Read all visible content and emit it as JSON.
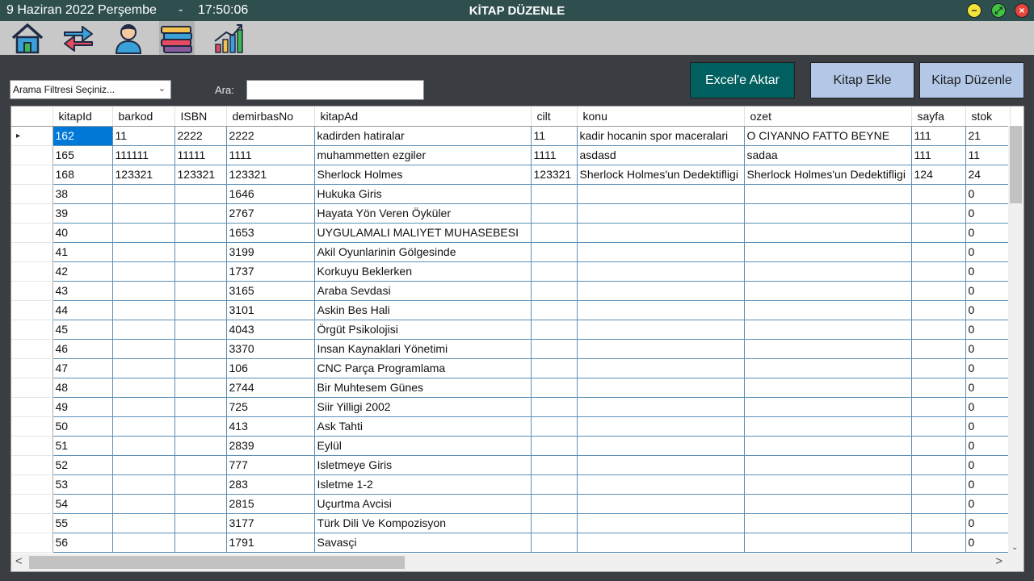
{
  "titlebar": {
    "date": "9 Haziran 2022 Perşembe",
    "separator": "-",
    "time": "17:50:06",
    "title": "KİTAP DÜZENLE",
    "min_glyph": "−",
    "max_glyph": "⤢",
    "close_glyph": "×",
    "colors": {
      "bar": "#2f4f4f",
      "min": "#f2e23a",
      "max": "#3fc53f",
      "close": "#e8453c"
    }
  },
  "toolbar": {
    "icons": [
      "home-icon",
      "transfer-arrows-icon",
      "user-icon",
      "books-icon",
      "chart-growth-icon"
    ],
    "active_index": 3
  },
  "filter": {
    "selected": "Arama Filtresi Seçiniz...",
    "ara_label": "Ara:",
    "search_value": ""
  },
  "buttons": {
    "excel": "Excel'e Aktar",
    "ekle": "Kitap Ekle",
    "duzenle": "Kitap Düzenle",
    "colors": {
      "excel": "#006060",
      "ekle": "#b3c7e6",
      "duzenle": "#b3c7e6"
    }
  },
  "grid": {
    "columns": [
      "kitapId",
      "barkod",
      "ISBN",
      "demirbasNo",
      "kitapAd",
      "cilt",
      "konu",
      "ozet",
      "sayfa",
      "stok"
    ],
    "rows": [
      [
        "162",
        "11",
        "2222",
        "2222",
        "kadirden hatiralar",
        "11",
        "kadir hocanin spor maceralari",
        "O CIYANNO FATTO BEYNE",
        "111",
        "21"
      ],
      [
        "165",
        "111111",
        "11111",
        "1111",
        "muhammetten  ezgiler",
        "1111",
        "asdasd",
        "sadaa",
        "111",
        "11"
      ],
      [
        "168",
        "123321",
        "123321",
        "123321",
        "Sherlock Holmes",
        "123321",
        "Sherlock Holmes'un Dedektifligi",
        "Sherlock Holmes'un Dedektifligi",
        "124",
        "24"
      ],
      [
        "38",
        "",
        "",
        "1646",
        "Hukuka Giris",
        "",
        "",
        "",
        "",
        "0"
      ],
      [
        "39",
        "",
        "",
        "2767",
        "Hayata Yön Veren Öyküler",
        "",
        "",
        "",
        "",
        "0"
      ],
      [
        "40",
        "",
        "",
        "1653",
        "UYGULAMALI MALIYET MUHASEBESI",
        "",
        "",
        "",
        "",
        "0"
      ],
      [
        "41",
        "",
        "",
        "3199",
        "Akil Oyunlarinin Gölgesinde",
        "",
        "",
        "",
        "",
        "0"
      ],
      [
        "42",
        "",
        "",
        "1737",
        "Korkuyu Beklerken",
        "",
        "",
        "",
        "",
        "0"
      ],
      [
        "43",
        "",
        "",
        "3165",
        "Araba Sevdasi",
        "",
        "",
        "",
        "",
        "0"
      ],
      [
        "44",
        "",
        "",
        "3101",
        "Askin Bes Hali",
        "",
        "",
        "",
        "",
        "0"
      ],
      [
        "45",
        "",
        "",
        "4043",
        "Örgüt Psikolojisi",
        "",
        "",
        "",
        "",
        "0"
      ],
      [
        "46",
        "",
        "",
        "3370",
        "Insan Kaynaklari Yönetimi",
        "",
        "",
        "",
        "",
        "0"
      ],
      [
        "47",
        "",
        "",
        "106",
        "CNC Parça Programlama",
        "",
        "",
        "",
        "",
        "0"
      ],
      [
        "48",
        "",
        "",
        "2744",
        "Bir Muhtesem Günes",
        "",
        "",
        "",
        "",
        "0"
      ],
      [
        "49",
        "",
        "",
        "725",
        "Siir Yilligi 2002",
        "",
        "",
        "",
        "",
        "0"
      ],
      [
        "50",
        "",
        "",
        "413",
        "Ask Tahti",
        "",
        "",
        "",
        "",
        "0"
      ],
      [
        "51",
        "",
        "",
        "2839",
        "Eylül",
        "",
        "",
        "",
        "",
        "0"
      ],
      [
        "52",
        "",
        "",
        "777",
        "Isletmeye Giris",
        "",
        "",
        "",
        "",
        "0"
      ],
      [
        "53",
        "",
        "",
        "283",
        "Isletme 1-2",
        "",
        "",
        "",
        "",
        "0"
      ],
      [
        "54",
        "",
        "",
        "2815",
        "Uçurtma Avcisi",
        "",
        "",
        "",
        "",
        "0"
      ],
      [
        "55",
        "",
        "",
        "3177",
        "Türk Dili Ve Kompozisyon",
        "",
        "",
        "",
        "",
        "0"
      ],
      [
        "56",
        "",
        "",
        "1791",
        "Savasçi",
        "",
        "",
        "",
        "",
        "0"
      ]
    ],
    "selected_row": 0,
    "current_row_marker": "▸",
    "scroll_left": "<",
    "scroll_right": ">",
    "scroll_down": "⌄",
    "grid_line_color": "#5b8fb8",
    "selection_color": "#0078d7"
  }
}
